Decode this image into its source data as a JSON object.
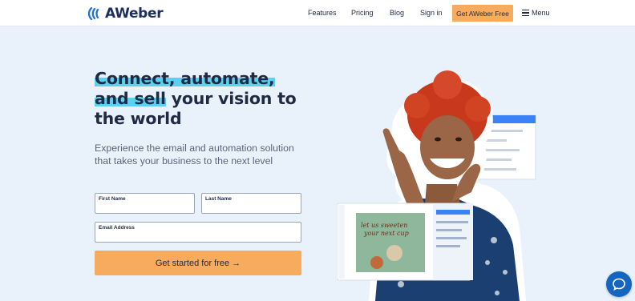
{
  "header": {
    "brand": "AWeber",
    "nav": [
      "Features",
      "Pricing",
      "Blog",
      "Sign in"
    ],
    "cta": "Get AWeber Free",
    "menu": "Menu"
  },
  "hero": {
    "headline_highlight_1": "Connect, automate,",
    "headline_highlight_2": "and sell",
    "headline_rest_1": " your vision to",
    "headline_rest_2": "the world",
    "subhead": "Experience the email and automation solution that takes your business to the next level"
  },
  "form": {
    "first_name_label": "First Name",
    "last_name_label": "Last Name",
    "email_label": "Email Address",
    "first_name_value": "",
    "last_name_value": "",
    "email_value": "",
    "submit": "Get started for free →"
  },
  "image": {
    "card_text_1": "let us sweeten",
    "card_text_2": "your next cup"
  },
  "colors": {
    "brand": "#1b2f5c",
    "accent": "#f7ab5f",
    "highlight": "#5dd0f0",
    "background": "#e9f2fb",
    "chat": "#1565c0"
  },
  "icons": [
    "aweber-logo-icon",
    "hamburger-icon",
    "chat-icon"
  ]
}
